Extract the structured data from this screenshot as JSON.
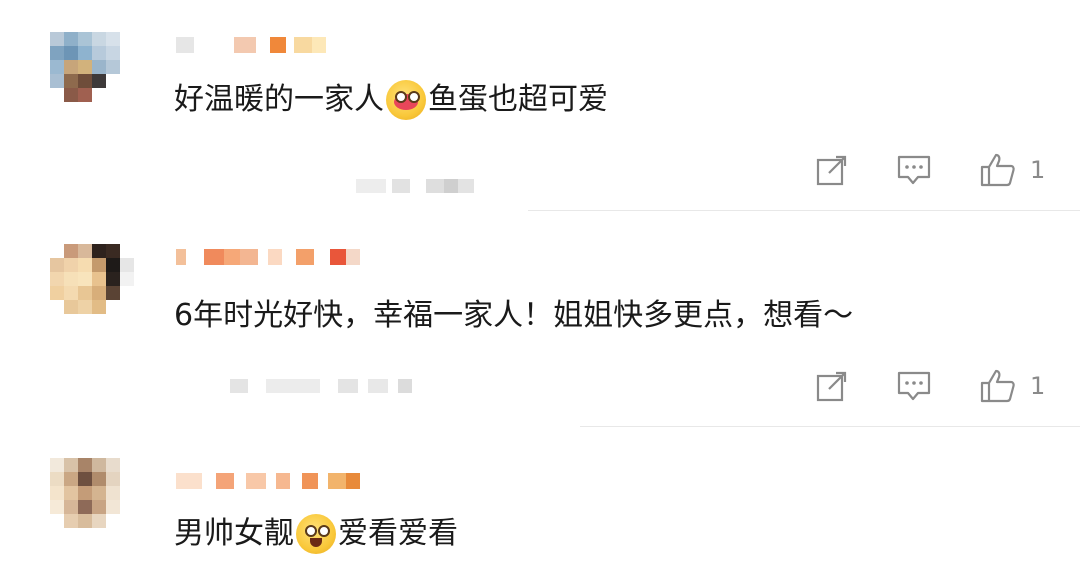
{
  "comments": [
    {
      "text_before": "好温暖的一家人",
      "emoji": "hug-face-emoji",
      "text_after": "鱼蛋也超可爱",
      "likes": "1"
    },
    {
      "text_before": "6年时光好快，幸福一家人！姐姐快多更点，想看～",
      "emoji": "",
      "text_after": "",
      "likes": "1"
    },
    {
      "text_before": "男帅女靓",
      "emoji": "starry-eyed-emoji",
      "text_after": "爱看爱看",
      "likes": ""
    }
  ],
  "icons": {
    "share": "share-icon",
    "reply": "reply-icon",
    "like": "thumbs-up-icon"
  },
  "colors": {
    "action_gray": "#8a8a8a",
    "divider": "#e8e8e8"
  }
}
